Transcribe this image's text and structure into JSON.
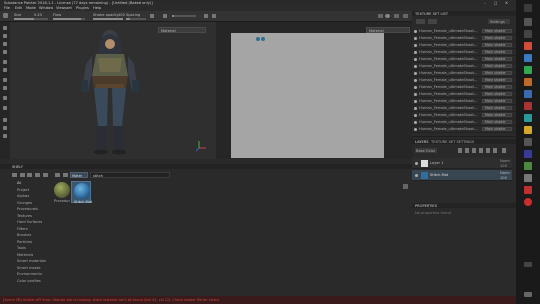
{
  "window": {
    "title": "Substance Painter 2018.1.1 - License (77 days remaining) - [Untitled (Baked only)]"
  },
  "menu": [
    "File",
    "Edit",
    "Mode",
    "Window",
    "Viewport",
    "Plugins",
    "Help"
  ],
  "toolbar": {
    "size_label": "Size",
    "size_value": "0.45",
    "flow_label": "Flow",
    "stroke_opacity_label": "Stroke opacity",
    "stroke_opacity_value": "100",
    "spacing_label": "Spacing"
  },
  "viewport3d": {
    "mode": "Material"
  },
  "viewport2d": {
    "mode": "Material"
  },
  "texture_set_list": {
    "title": "TEXTURE SET LIST",
    "settings_label": "Settings",
    "items": [
      {
        "name": "Human_Female_ultimateShoot...",
        "shader": "Main shader"
      },
      {
        "name": "Human_Female_ultimateShoot...",
        "shader": "Main shader"
      },
      {
        "name": "Human_Female_ultimateShoot...",
        "shader": "Main shader"
      },
      {
        "name": "Human_Female_ultimateShoot...",
        "shader": "Main shader"
      },
      {
        "name": "Human_Female_ultimateShoot...",
        "shader": "Main shader"
      },
      {
        "name": "Human_Female_ultimateShoot...",
        "shader": "Main shader"
      },
      {
        "name": "Human_Female_ultimateShoot...",
        "shader": "Main shader"
      },
      {
        "name": "Human_Female_ultimateShoot...",
        "shader": "Main shader"
      },
      {
        "name": "Human_Female_ultimateShoot...",
        "shader": "Main shader"
      },
      {
        "name": "Human_Female_ultimateShoot...",
        "shader": "Main shader"
      },
      {
        "name": "Human_Female_ultimateShoot...",
        "shader": "Main shader"
      },
      {
        "name": "Human_Female_ultimateShoot...",
        "shader": "Main shader"
      },
      {
        "name": "Human_Female_ultimateShoot...",
        "shader": "Main shader"
      },
      {
        "name": "Human_Female_ultimateShoot...",
        "shader": "Main shader"
      },
      {
        "name": "Human_Female_ultimateShoot...",
        "shader": "Main shader"
      }
    ]
  },
  "layers": {
    "tab_layers": "LAYERS",
    "tab_tss": "TEXTURE SET SETTINGS",
    "base_color": "Base Color",
    "items": [
      {
        "name": "Layer 1",
        "blend": "Norm",
        "opacity": "100"
      },
      {
        "name": "Stitch Mat",
        "blend": "Norm",
        "opacity": "100"
      }
    ]
  },
  "properties": {
    "title": "PROPERTIES",
    "empty": "No properties found"
  },
  "shelf": {
    "title": "SHELF",
    "filter_value": "Mater",
    "search_value": "stitch",
    "categories": [
      "All",
      "Project",
      "Alphas",
      "Grunges",
      "Procedurals",
      "Textures",
      "Hard Surfaces",
      "Filters",
      "Brushes",
      "Particles",
      "Tools",
      "Materials",
      "Smart materials",
      "Smart masks",
      "Environments",
      "Color profiles"
    ],
    "assets": [
      {
        "name": "Procedur"
      },
      {
        "name": "Stitch Mat"
      }
    ]
  },
  "statusbar": {
    "message": "[Scene 3D] Shader API Error: Texture slot is missing; stitch material can't be found (line 41, col 12). Check shader file for errors."
  },
  "colors": {
    "accent": "#3a8ad6",
    "uv_plane": "#a5a5a5",
    "status_error": "#d04a3a"
  }
}
